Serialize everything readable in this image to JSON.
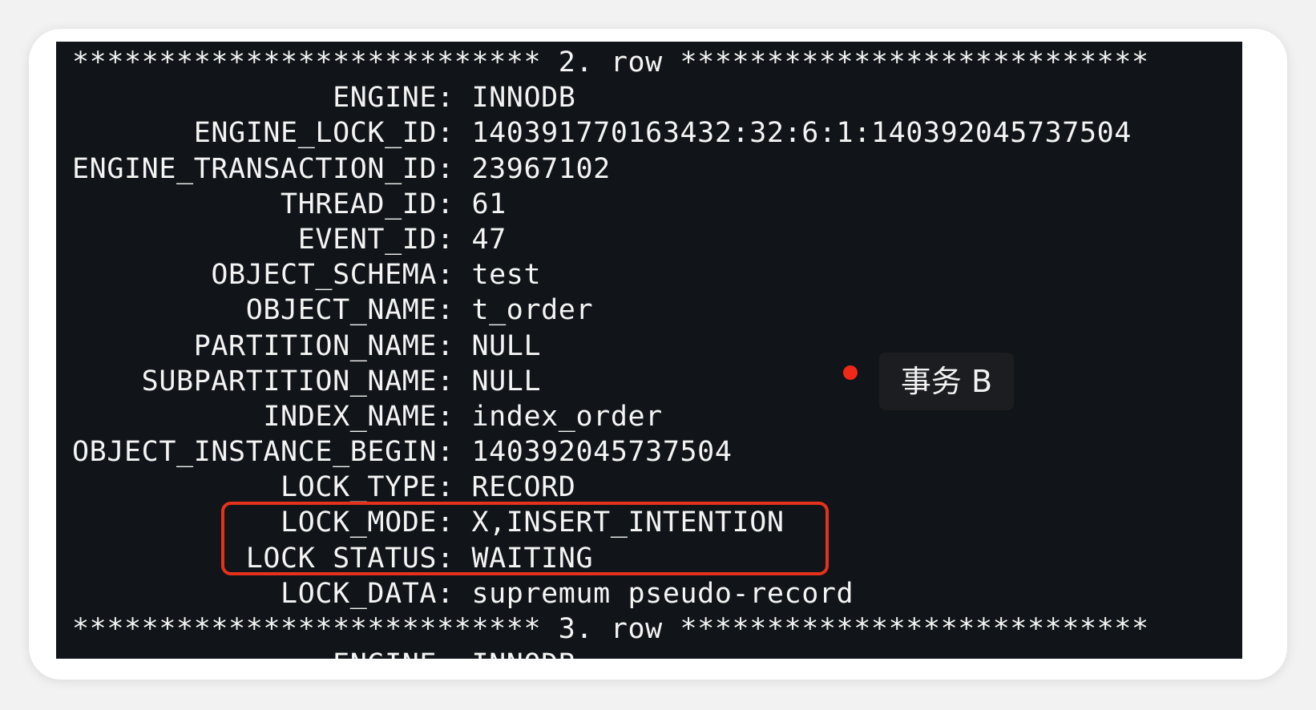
{
  "terminal": {
    "lines": [
      "*************************** 2. row ***************************",
      "               ENGINE: INNODB",
      "       ENGINE_LOCK_ID: 140391770163432:32:6:1:140392045737504",
      "ENGINE_TRANSACTION_ID: 23967102",
      "            THREAD_ID: 61",
      "             EVENT_ID: 47",
      "        OBJECT_SCHEMA: test",
      "          OBJECT_NAME: t_order",
      "       PARTITION_NAME: NULL",
      "    SUBPARTITION_NAME: NULL",
      "           INDEX_NAME: index_order",
      "OBJECT_INSTANCE_BEGIN: 140392045737504",
      "            LOCK_TYPE: RECORD",
      "            LOCK_MODE: X,INSERT_INTENTION",
      "          LOCK_STATUS: WAITING",
      "            LOCK_DATA: supremum pseudo-record",
      "*************************** 3. row ***************************",
      "               ENGINE: INNODB"
    ]
  },
  "annotation": {
    "label": "事务 B",
    "dot_color": "#f0281a",
    "highlight_color": "#e5321c"
  }
}
